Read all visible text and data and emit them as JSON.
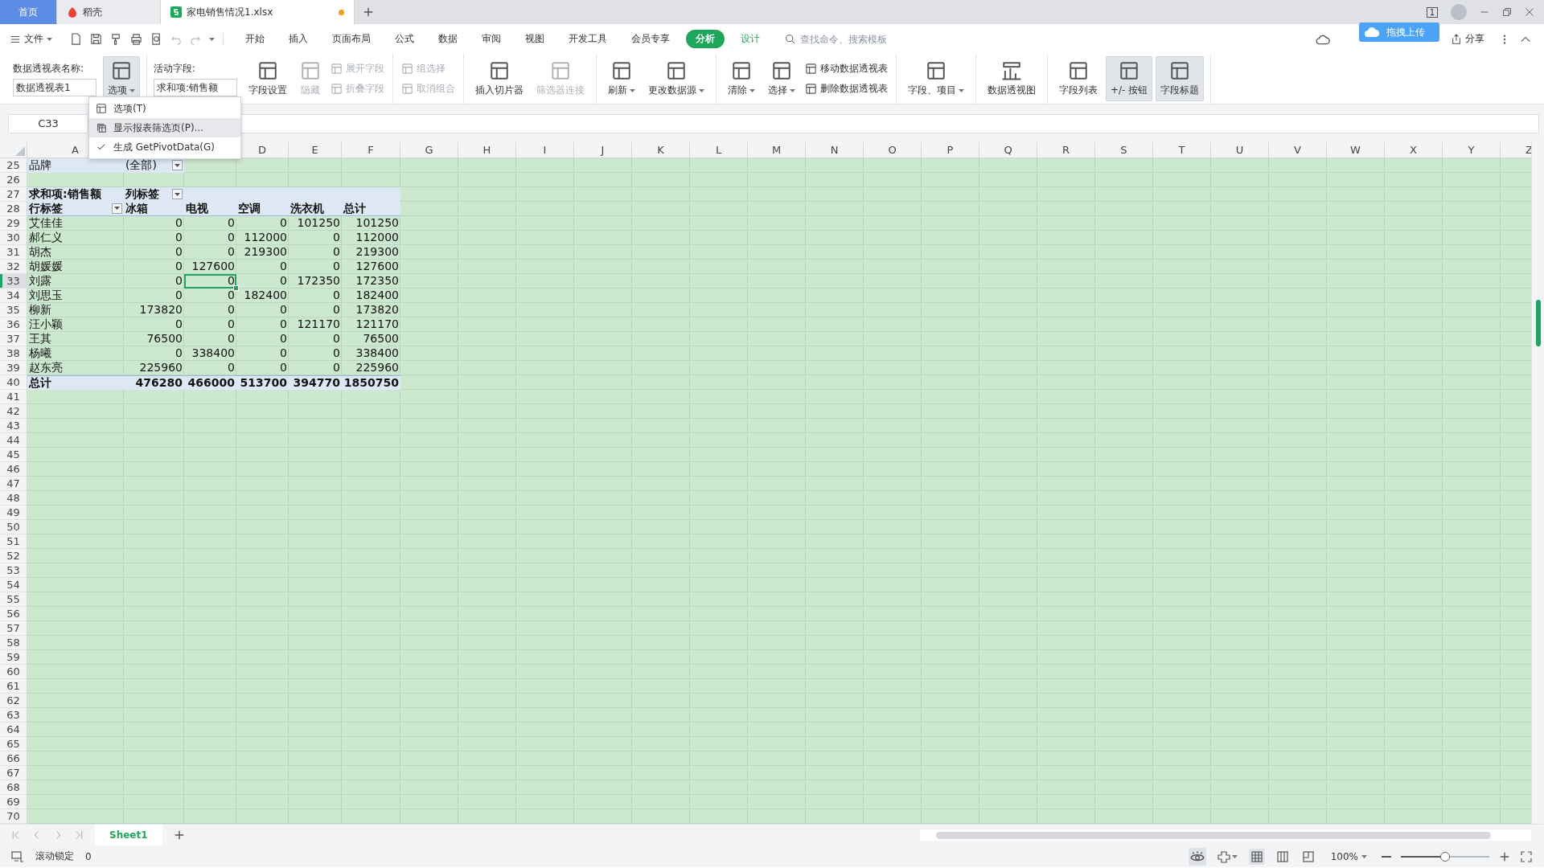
{
  "tabs": [
    {
      "label": "首页",
      "kind": "home",
      "selected": false,
      "unsaved": false
    },
    {
      "label": "稻壳",
      "kind": "docer",
      "selected": false,
      "unsaved": false
    },
    {
      "label": "家电销售情况1.xlsx",
      "kind": "sheet",
      "selected": true,
      "unsaved": true
    }
  ],
  "window_badge": "1",
  "menu": {
    "file": "文件",
    "items": [
      {
        "label": "开始",
        "kind": "tab",
        "selected": false
      },
      {
        "label": "插入",
        "kind": "tab",
        "selected": false
      },
      {
        "label": "页面布局",
        "kind": "tab",
        "selected": false
      },
      {
        "label": "公式",
        "kind": "tab",
        "selected": false
      },
      {
        "label": "数据",
        "kind": "tab",
        "selected": false
      },
      {
        "label": "审阅",
        "kind": "tab",
        "selected": false
      },
      {
        "label": "视图",
        "kind": "tab",
        "selected": false
      },
      {
        "label": "开发工具",
        "kind": "tab",
        "selected": false
      },
      {
        "label": "会员专享",
        "kind": "tab",
        "selected": false
      },
      {
        "label": "分析",
        "kind": "context",
        "selected": true
      },
      {
        "label": "设计",
        "kind": "context",
        "selected": false
      }
    ],
    "search": {
      "placeholder": "查找命令、搜索模板"
    },
    "upload": "拖拽上传",
    "share": "分享"
  },
  "ribbon": {
    "groups": [
      {
        "items": [
          {
            "kind": "field",
            "label": "数据透视表名称:",
            "value": "数据透视表1"
          },
          {
            "kind": "large",
            "label": "选项",
            "dropdown": true,
            "pressed": true,
            "disabled": false
          }
        ]
      },
      {
        "items": [
          {
            "kind": "field",
            "label": "活动字段:",
            "value": "求和项:销售额"
          },
          {
            "kind": "large",
            "label": "字段设置",
            "dropdown": false,
            "pressed": false,
            "disabled": false
          },
          {
            "kind": "large",
            "label": "隐藏",
            "dropdown": false,
            "pressed": false,
            "disabled": true
          },
          {
            "kind": "stack",
            "buttons": [
              {
                "label": "展开字段",
                "disabled": true
              },
              {
                "label": "折叠字段",
                "disabled": true
              }
            ]
          }
        ]
      },
      {
        "items": [
          {
            "kind": "stack",
            "buttons": [
              {
                "label": "组选择",
                "disabled": true
              },
              {
                "label": "取消组合",
                "disabled": true
              }
            ]
          }
        ]
      },
      {
        "items": [
          {
            "kind": "large",
            "label": "插入切片器",
            "dropdown": false,
            "pressed": false,
            "disabled": false
          },
          {
            "kind": "large",
            "label": "筛选器连接",
            "dropdown": false,
            "pressed": false,
            "disabled": true
          }
        ]
      },
      {
        "items": [
          {
            "kind": "large",
            "label": "刷新",
            "dropdown": true,
            "pressed": false,
            "disabled": false
          },
          {
            "kind": "large",
            "label": "更改数据源",
            "dropdown": true,
            "pressed": false,
            "disabled": false
          }
        ]
      },
      {
        "items": [
          {
            "kind": "large",
            "label": "清除",
            "dropdown": true,
            "pressed": false,
            "disabled": false
          },
          {
            "kind": "large",
            "label": "选择",
            "dropdown": true,
            "pressed": false,
            "disabled": false
          },
          {
            "kind": "stack",
            "buttons": [
              {
                "label": "移动数据透视表",
                "disabled": false
              },
              {
                "label": "删除数据透视表",
                "disabled": false
              }
            ]
          }
        ]
      },
      {
        "items": [
          {
            "kind": "large",
            "label": "字段、项目",
            "dropdown": true,
            "pressed": false,
            "disabled": false
          }
        ]
      },
      {
        "items": [
          {
            "kind": "large",
            "label": "数据透视图",
            "dropdown": false,
            "pressed": false,
            "disabled": false
          }
        ]
      },
      {
        "items": [
          {
            "kind": "large",
            "label": "字段列表",
            "dropdown": false,
            "pressed": false,
            "disabled": false
          },
          {
            "kind": "large",
            "label": "+/- 按钮",
            "dropdown": false,
            "pressed": true,
            "disabled": false
          },
          {
            "kind": "large",
            "label": "字段标题",
            "dropdown": false,
            "pressed": true,
            "disabled": false
          }
        ]
      }
    ]
  },
  "options_menu": {
    "items": [
      {
        "label": "选项(T)",
        "checked": false,
        "highlighted": false
      },
      {
        "label": "显示报表筛选页(P)...",
        "checked": false,
        "highlighted": true
      },
      {
        "label": "生成 GetPivotData(G)",
        "checked": true,
        "highlighted": false
      }
    ]
  },
  "name_box": "C33",
  "columns": [
    {
      "label": "A"
    },
    {},
    {},
    {
      "label": "D"
    },
    {
      "label": "E"
    },
    {
      "label": "F"
    },
    {
      "label": "G"
    },
    {
      "label": "H"
    },
    {
      "label": "I"
    },
    {
      "label": "J"
    },
    {
      "label": "K"
    },
    {
      "label": "L"
    },
    {
      "label": "M"
    },
    {
      "label": "N"
    },
    {
      "label": "O"
    },
    {
      "label": "P"
    },
    {
      "label": "Q"
    },
    {
      "label": "R"
    },
    {
      "label": "S"
    },
    {
      "label": "T"
    },
    {
      "label": "U"
    },
    {
      "label": "V"
    },
    {
      "label": "W"
    },
    {
      "label": "X"
    },
    {
      "label": "Y"
    },
    {
      "label": "Z"
    }
  ],
  "rows": [
    {
      "number": "25",
      "kind": "filter",
      "selected": false,
      "cells": [
        "品牌",
        "(全部)"
      ]
    },
    {
      "number": "26",
      "kind": "empty",
      "selected": false
    },
    {
      "number": "27",
      "kind": "pivot_title",
      "selected": false,
      "cells": [
        "求和项:销售额",
        "列标签"
      ]
    },
    {
      "number": "28",
      "kind": "column_labels",
      "selected": false,
      "cells": [
        "行标签",
        "冰箱",
        "电视",
        "空调",
        "洗衣机",
        "总计"
      ]
    },
    {
      "number": "29",
      "kind": "data",
      "selected": false,
      "cells": [
        "艾佳佳",
        "0",
        "0",
        "0",
        "101250",
        "101250"
      ]
    },
    {
      "number": "30",
      "kind": "data",
      "selected": false,
      "cells": [
        "郝仁义",
        "0",
        "0",
        "112000",
        "0",
        "112000"
      ]
    },
    {
      "number": "31",
      "kind": "data",
      "selected": false,
      "cells": [
        "胡杰",
        "0",
        "0",
        "219300",
        "0",
        "219300"
      ]
    },
    {
      "number": "32",
      "kind": "data",
      "selected": false,
      "cells": [
        "胡媛媛",
        "0",
        "127600",
        "0",
        "0",
        "127600"
      ]
    },
    {
      "number": "33",
      "kind": "data",
      "selected": true,
      "cells": [
        "刘露",
        "0",
        {
          "value": "0",
          "selected": true
        },
        "0",
        "172350",
        "172350"
      ]
    },
    {
      "number": "34",
      "kind": "data",
      "selected": false,
      "cells": [
        "刘思玉",
        "0",
        "0",
        "182400",
        "0",
        "182400"
      ]
    },
    {
      "number": "35",
      "kind": "data",
      "selected": false,
      "cells": [
        "柳新",
        "173820",
        "0",
        "0",
        "0",
        "173820"
      ]
    },
    {
      "number": "36",
      "kind": "data",
      "selected": false,
      "cells": [
        "汪小颖",
        "0",
        "0",
        "0",
        "121170",
        "121170"
      ]
    },
    {
      "number": "37",
      "kind": "data",
      "selected": false,
      "cells": [
        "王其",
        "76500",
        "0",
        "0",
        "0",
        "76500"
      ]
    },
    {
      "number": "38",
      "kind": "data",
      "selected": false,
      "cells": [
        "杨曦",
        "0",
        "338400",
        "0",
        "0",
        "338400"
      ]
    },
    {
      "number": "39",
      "kind": "data",
      "selected": false,
      "cells": [
        "赵东亮",
        "225960",
        "0",
        "0",
        "0",
        "225960"
      ]
    },
    {
      "number": "40",
      "kind": "total",
      "selected": false,
      "cells": [
        "总计",
        "476280",
        "466000",
        "513700",
        "394770",
        "1850750"
      ]
    },
    {
      "number": "41",
      "kind": "empty",
      "selected": false
    },
    {
      "number": "42",
      "kind": "empty",
      "selected": false
    },
    {
      "number": "43",
      "kind": "empty",
      "selected": false
    },
    {
      "number": "44",
      "kind": "empty",
      "selected": false
    },
    {
      "number": "45",
      "kind": "empty",
      "selected": false
    },
    {
      "number": "46",
      "kind": "empty",
      "selected": false
    },
    {
      "number": "47",
      "kind": "empty",
      "selected": false
    },
    {
      "number": "48",
      "kind": "empty",
      "selected": false
    },
    {
      "number": "49",
      "kind": "empty",
      "selected": false
    },
    {
      "number": "50",
      "kind": "empty",
      "selected": false
    },
    {
      "number": "51",
      "kind": "empty",
      "selected": false
    },
    {
      "number": "52",
      "kind": "empty",
      "selected": false
    },
    {
      "number": "53",
      "kind": "empty",
      "selected": false
    },
    {
      "number": "54",
      "kind": "empty",
      "selected": false
    },
    {
      "number": "55",
      "kind": "empty",
      "selected": false
    },
    {
      "number": "56",
      "kind": "empty",
      "selected": false
    },
    {
      "number": "57",
      "kind": "empty",
      "selected": false
    },
    {
      "number": "58",
      "kind": "empty",
      "selected": false
    },
    {
      "number": "59",
      "kind": "empty",
      "selected": false
    },
    {
      "number": "60",
      "kind": "empty",
      "selected": false
    },
    {
      "number": "61",
      "kind": "empty",
      "selected": false
    },
    {
      "number": "62",
      "kind": "empty",
      "selected": false
    },
    {
      "number": "63",
      "kind": "empty",
      "selected": false
    },
    {
      "number": "64",
      "kind": "empty",
      "selected": false
    },
    {
      "number": "65",
      "kind": "empty",
      "selected": false
    },
    {
      "number": "66",
      "kind": "empty",
      "selected": false
    },
    {
      "number": "67",
      "kind": "empty",
      "selected": false
    },
    {
      "number": "68",
      "kind": "empty",
      "selected": false
    },
    {
      "number": "69",
      "kind": "empty",
      "selected": false
    },
    {
      "number": "70",
      "kind": "empty",
      "selected": false
    }
  ],
  "sheet_tabs": [
    {
      "label": "Sheet1",
      "selected": true
    }
  ],
  "status_bar": {
    "scroll_lock": "滚动锁定",
    "value": "0",
    "zoom": "100%",
    "zoom_slider": {
      "level": 0.5
    }
  }
}
